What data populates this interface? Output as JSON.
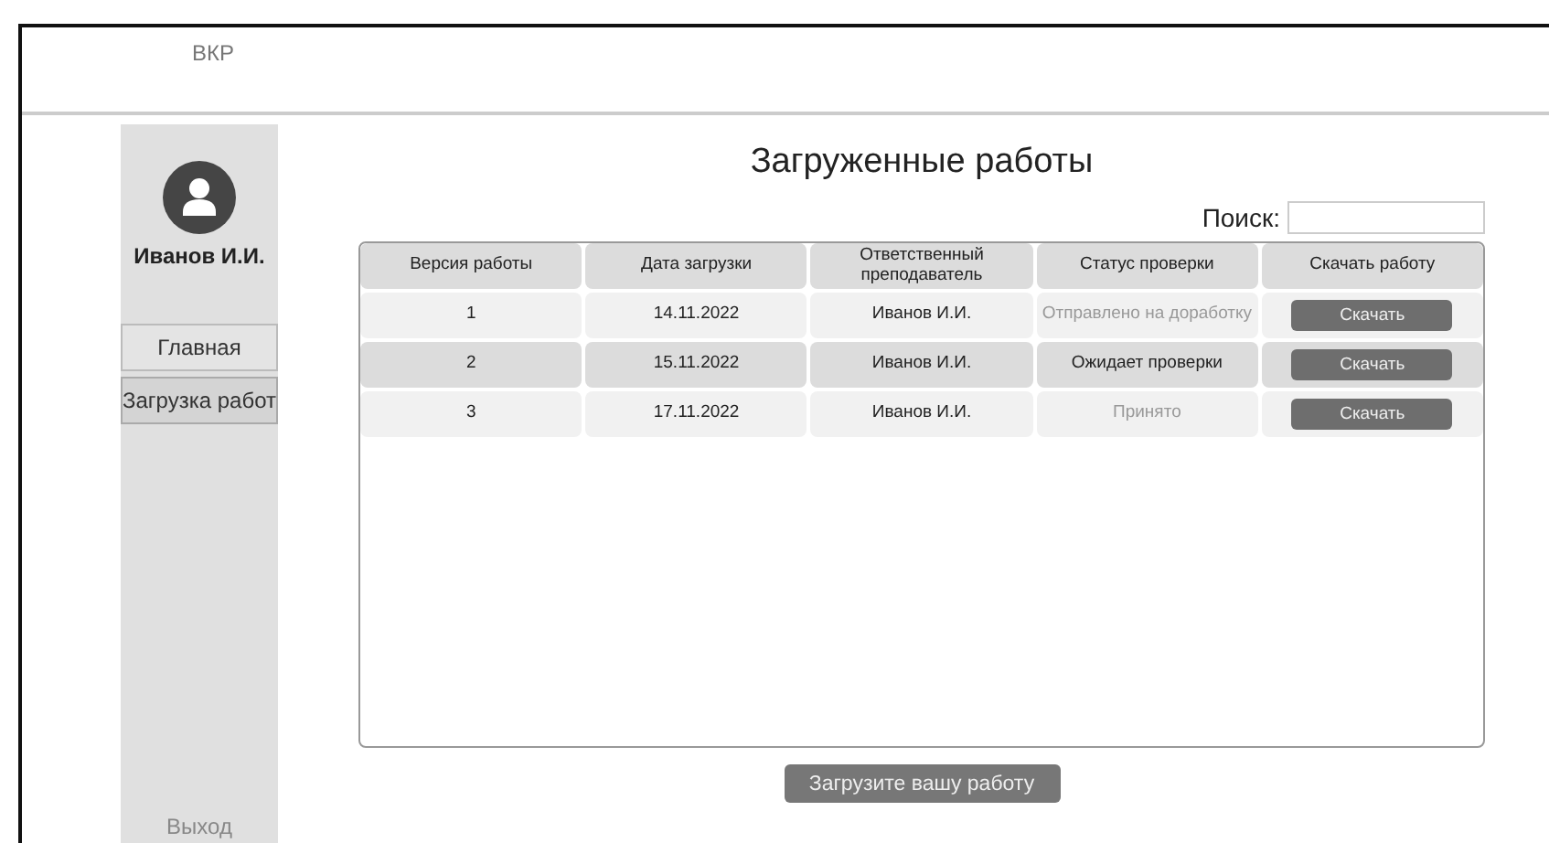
{
  "header": {
    "title": "ВКР"
  },
  "sidebar": {
    "user_name": "Иванов И.И.",
    "items": [
      {
        "label": "Главная",
        "selected": false
      },
      {
        "label": "Загрузка работ",
        "selected": true
      }
    ],
    "logout": "Выход"
  },
  "main": {
    "title": "Загруженные работы",
    "search": {
      "label": "Поиск:"
    },
    "table": {
      "columns": [
        "Версия работы",
        "Дата загрузки",
        "Ответственный преподаватель",
        "Статус проверки",
        "Скачать работу"
      ],
      "rows": [
        {
          "version": "1",
          "date": "14.11.2022",
          "teacher": "Иванов И.И.",
          "status": "Отправлено на доработку",
          "status_muted": true,
          "action": "Скачать"
        },
        {
          "version": "2",
          "date": "15.11.2022",
          "teacher": "Иванов И.И.",
          "status": "Ожидает проверки",
          "status_muted": false,
          "action": "Скачать"
        },
        {
          "version": "3",
          "date": "17.11.2022",
          "teacher": "Иванов И.И.",
          "status": "Принято",
          "status_muted": true,
          "action": "Скачать"
        }
      ]
    },
    "upload_button": "Загрузите вашу работу"
  }
}
